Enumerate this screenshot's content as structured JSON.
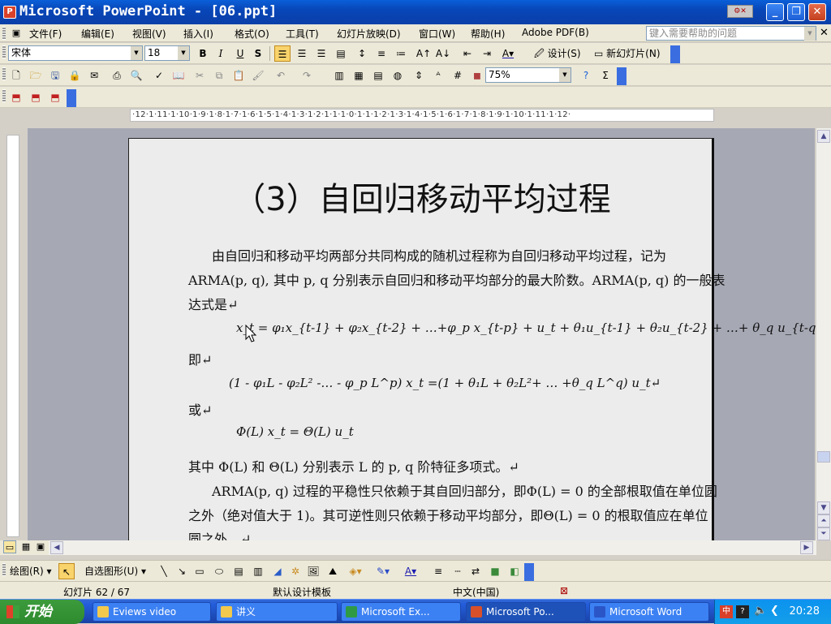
{
  "window": {
    "title": "Microsoft PowerPoint - [06.ppt]",
    "icon_label": "P"
  },
  "menu": {
    "items": [
      "文件(F)",
      "编辑(E)",
      "视图(V)",
      "插入(I)",
      "格式(O)",
      "工具(T)",
      "幻灯片放映(D)",
      "窗口(W)",
      "帮助(H)",
      "Adobe PDF(B)"
    ],
    "help_placeholder": "键入需要帮助的问题"
  },
  "format_bar": {
    "font": "宋体",
    "size": "18",
    "bold": "B",
    "italic": "I",
    "underline": "U",
    "shadow": "S",
    "design_label": "设计(S)",
    "new_slide_label": "新幻灯片(N)"
  },
  "standard_bar": {
    "zoom": "75%"
  },
  "ruler": {
    "h_ticks": "·12·1·11·1·10·1·9·1·8·1·7·1·6·1·5·1·4·1·3·1·2·1·1·1·0·1·1·1·2·1·3·1·4·1·5·1·6·1·7·1·8·1·9·1·10·1·11·1·12·"
  },
  "slide": {
    "title": "（3）自回归移动平均过程",
    "p1": "由自回归和移动平均两部分共同构成的随机过程称为自回归移动平均过程，记为",
    "p2": "ARMA(p, q), 其中 p, q 分别表示自回归和移动平均部分的最大阶数。ARMA(p, q) 的一般表",
    "p3": "达式是↵",
    "eq1": "x_t = φ₁x_{t-1} + φ₂x_{t-2} + …+φ_p x_{t-p} + u_t + θ₁u_{t-1} + θ₂u_{t-2} + …+ θ_q u_{t-q}",
    "ji": "即↵",
    "eq2": "(1 - φ₁L - φ₂L² -… - φ_p L^p) x_t =(1 + θ₁L + θ₂L²+ … +θ_q L^q) u_t↵",
    "huo": "或↵",
    "eq3": "Φ(L) x_t = Θ(L) u_t",
    "p4": "其中  Φ(L) 和  Θ(L) 分别表示 L 的 p, q 阶特征多项式。↵",
    "p5": "ARMA(p, q) 过程的平稳性只依赖于其自回归部分，即Φ(L) = 0 的全部根取值在单位圆",
    "p6": "之外（绝对值大于 1)。其可逆性则只依赖于移动平均部分，即Θ(L) = 0 的根取值应在单位",
    "p7": "圆之外。↵"
  },
  "drawing_bar": {
    "draw_label": "绘图(R)",
    "autoshapes_label": "自选图形(U)"
  },
  "status": {
    "slide": "幻灯片 62 / 67",
    "template": "默认设计模板",
    "language": "中文(中国)"
  },
  "taskbar": {
    "start": "开始",
    "tasks": [
      "Eviews video",
      "讲义",
      "Microsoft Ex...",
      "Microsoft Po...",
      "Microsoft Word"
    ],
    "clock": "20:28"
  }
}
